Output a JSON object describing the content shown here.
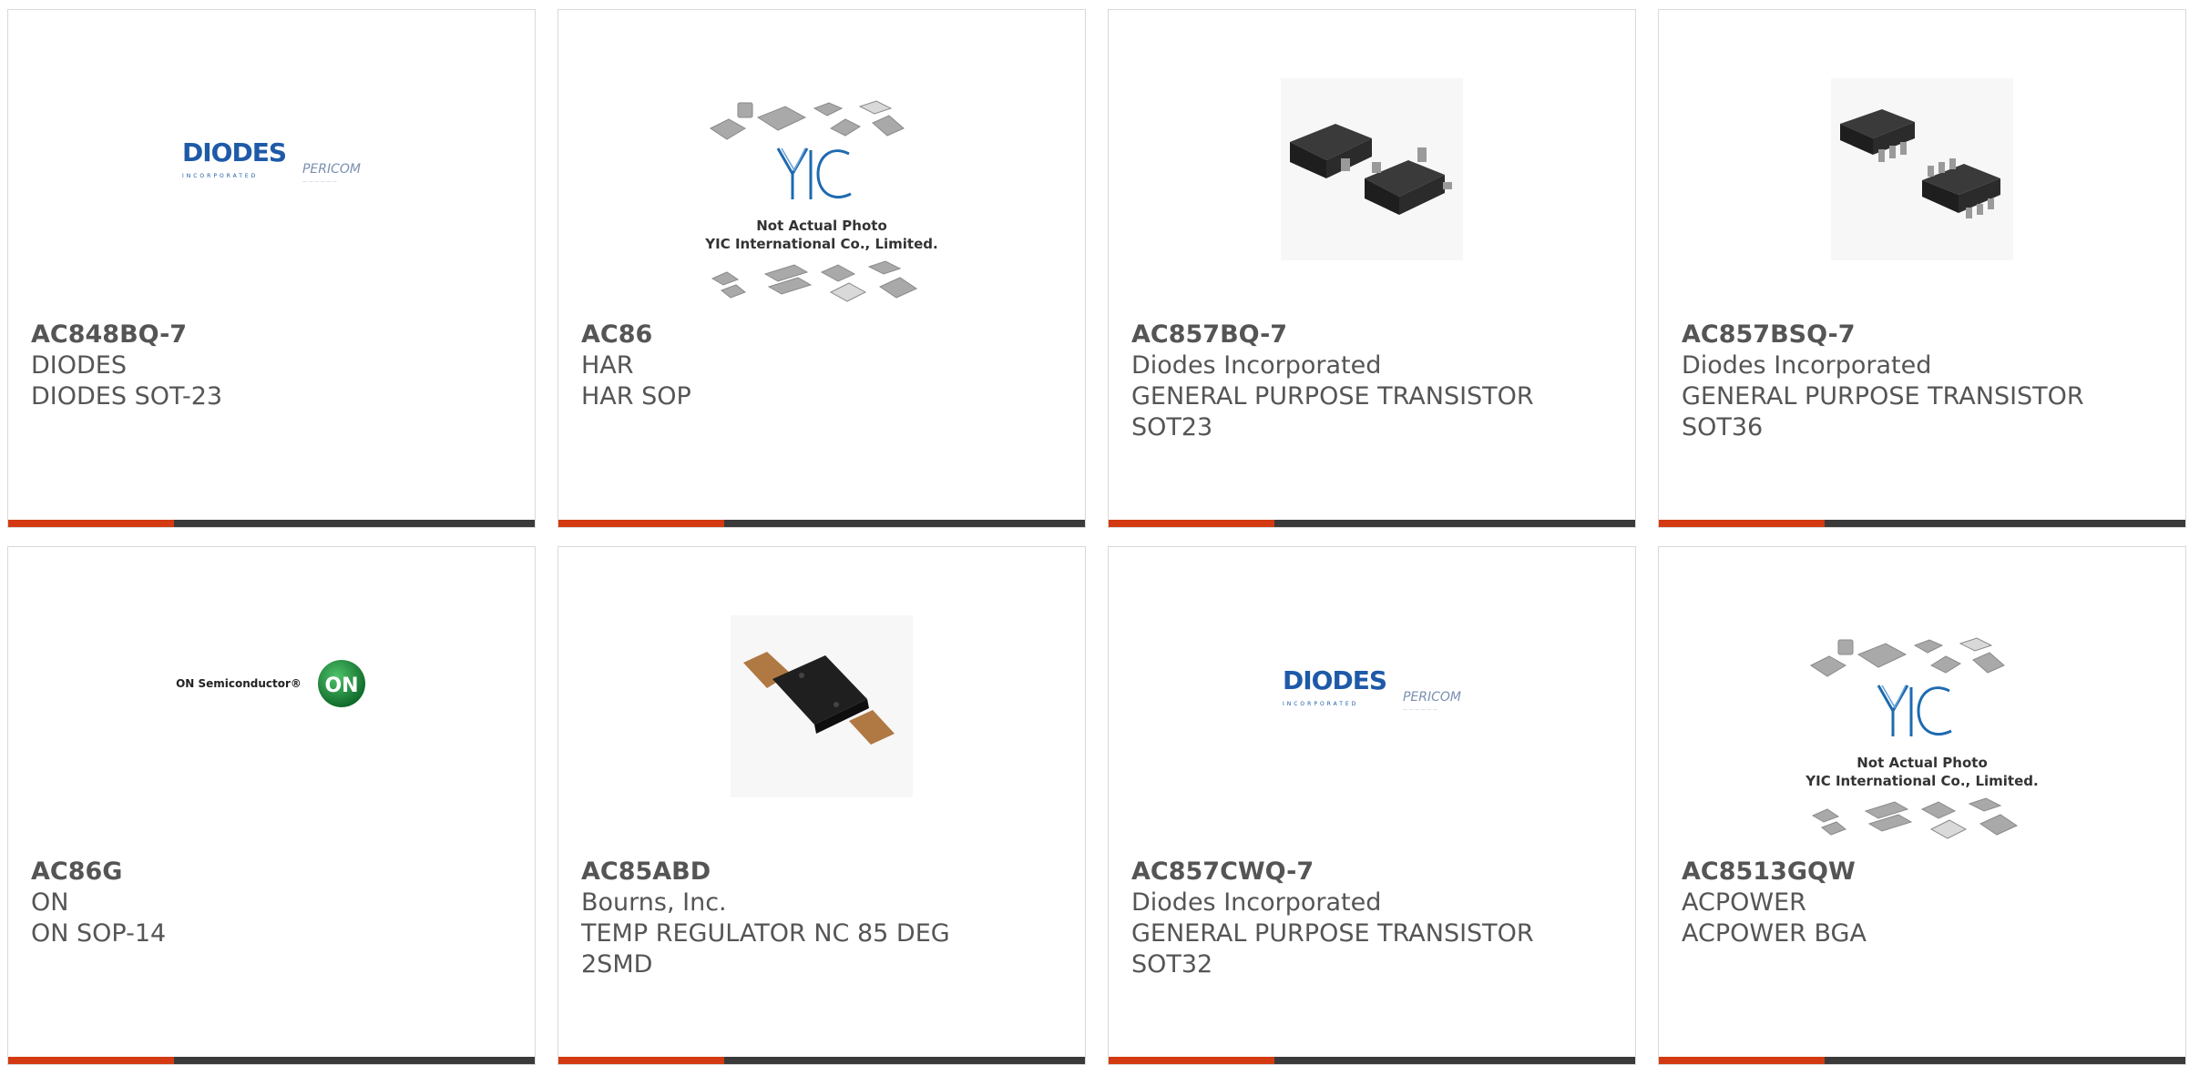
{
  "products": [
    {
      "part": "AC848BQ-7",
      "lines": [
        "DIODES",
        "DIODES SOT-23"
      ],
      "image": "diodes-pericom-logo"
    },
    {
      "part": "AC86",
      "lines": [
        "HAR",
        "HAR SOP"
      ],
      "image": "yic-not-actual-photo",
      "photo_caption": [
        "Not Actual Photo",
        "YIC International Co., Limited."
      ]
    },
    {
      "part": "AC857BQ-7",
      "lines": [
        "Diodes Incorporated",
        "GENERAL PURPOSE TRANSISTOR",
        "SOT23"
      ],
      "image": "sot23-package"
    },
    {
      "part": "AC857BSQ-7",
      "lines": [
        "Diodes Incorporated",
        "GENERAL PURPOSE TRANSISTOR",
        "SOT36"
      ],
      "image": "sot363-package"
    },
    {
      "part": "AC86G",
      "lines": [
        "ON",
        "ON SOP-14"
      ],
      "image": "on-semiconductor-logo",
      "logo_text": "ON Semiconductor®",
      "logo_badge": "ON"
    },
    {
      "part": "AC85ABD",
      "lines": [
        "Bourns, Inc.",
        "TEMP REGULATOR NC 85 DEG",
        "2SMD"
      ],
      "image": "thermal-cutoff-photo"
    },
    {
      "part": "AC857CWQ-7",
      "lines": [
        "Diodes Incorporated",
        "GENERAL PURPOSE TRANSISTOR",
        "SOT32"
      ],
      "image": "diodes-pericom-logo"
    },
    {
      "part": "AC8513GQW",
      "lines": [
        "ACPOWER",
        "ACPOWER BGA"
      ],
      "image": "yic-not-actual-photo",
      "photo_caption": [
        "Not Actual Photo",
        "YIC International Co., Limited."
      ]
    }
  ],
  "logos": {
    "diodes": "DIODES",
    "diodes_sub": "INCORPORATED",
    "pericom": "PERICOM",
    "yic": "YIC"
  },
  "colors": {
    "accent": "#d33a12",
    "bar": "#3a3a3a",
    "text": "#555555",
    "diodes_blue": "#1e5aa8",
    "on_green": "#1c8a3a"
  }
}
